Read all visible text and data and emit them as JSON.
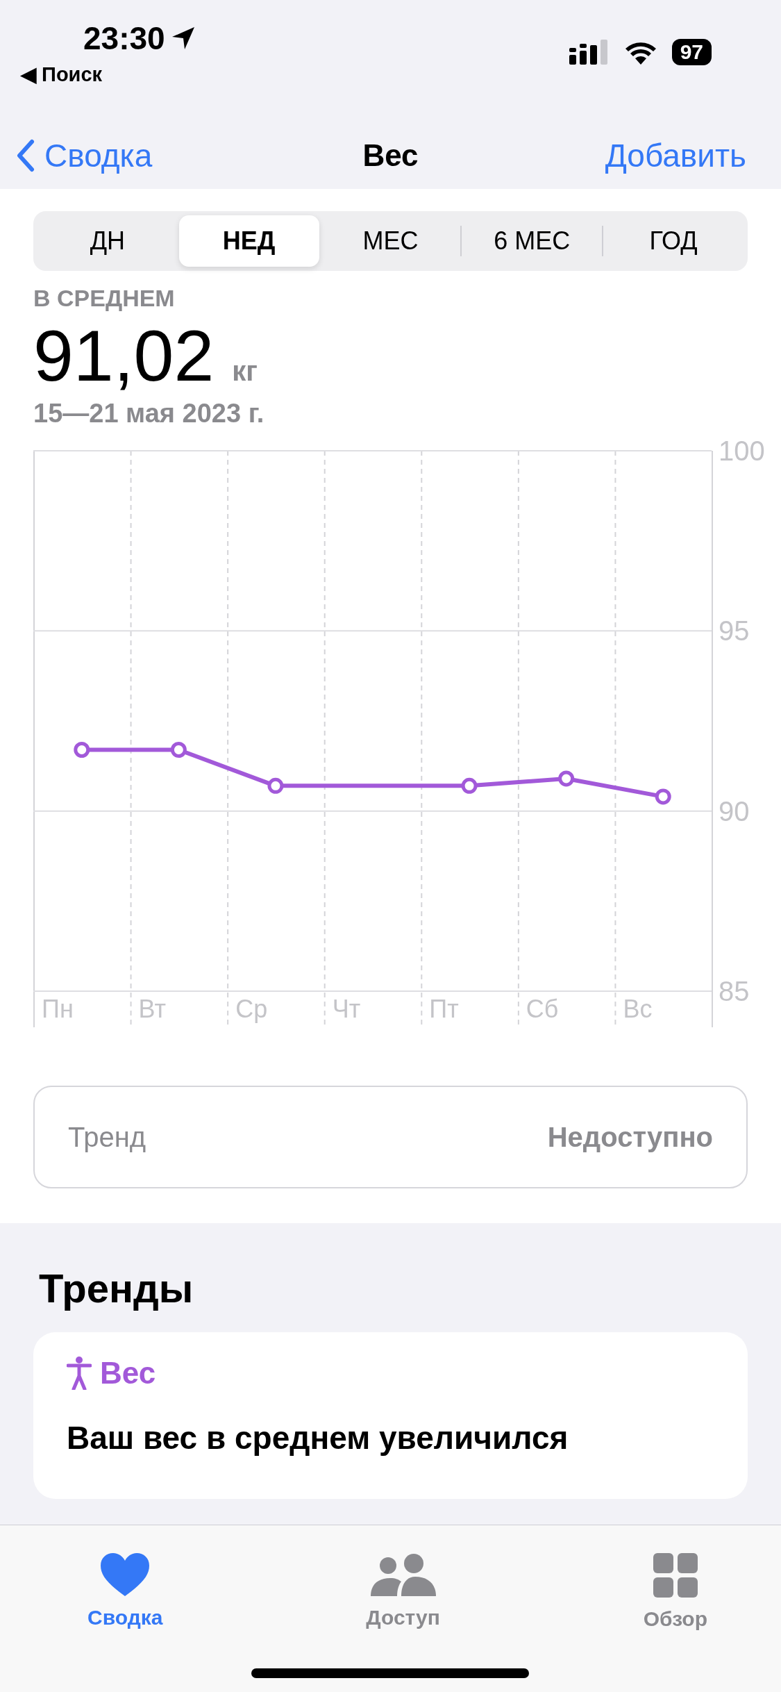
{
  "status_bar": {
    "time": "23:30",
    "back_app": "◀ Поиск",
    "battery": "97"
  },
  "nav": {
    "back": "Сводка",
    "title": "Вес",
    "action": "Добавить"
  },
  "segments": [
    {
      "label": "ДН",
      "selected": false
    },
    {
      "label": "НЕД",
      "selected": true
    },
    {
      "label": "МЕС",
      "selected": false
    },
    {
      "label": "6 МЕС",
      "selected": false
    },
    {
      "label": "ГОД",
      "selected": false
    }
  ],
  "summary": {
    "caption": "В СРЕДНЕМ",
    "value": "91,02",
    "unit": "кг",
    "range": "15—21 мая 2023 г."
  },
  "chart_data": {
    "type": "line",
    "categories": [
      "Пн",
      "Вт",
      "Ср",
      "Чт",
      "Пт",
      "Сб",
      "Вс"
    ],
    "series": [
      {
        "color": "#a259d9",
        "marker": true,
        "values": [
          91.7,
          91.7,
          90.7,
          null,
          90.7,
          90.9,
          90.4
        ]
      }
    ],
    "ylim": [
      85,
      100
    ],
    "yticks": [
      85,
      90,
      95,
      100
    ]
  },
  "trend_row": {
    "label": "Тренд",
    "value": "Недоступно"
  },
  "trends": {
    "heading": "Тренды",
    "card": {
      "category": "Вес",
      "text": "Ваш вес в среднем увеличился"
    }
  },
  "tab_bar": [
    {
      "kind": "heart",
      "label": "Сводка",
      "selected": true
    },
    {
      "kind": "people",
      "label": "Доступ",
      "selected": false
    },
    {
      "kind": "grid",
      "label": "Обзор",
      "selected": false
    }
  ]
}
